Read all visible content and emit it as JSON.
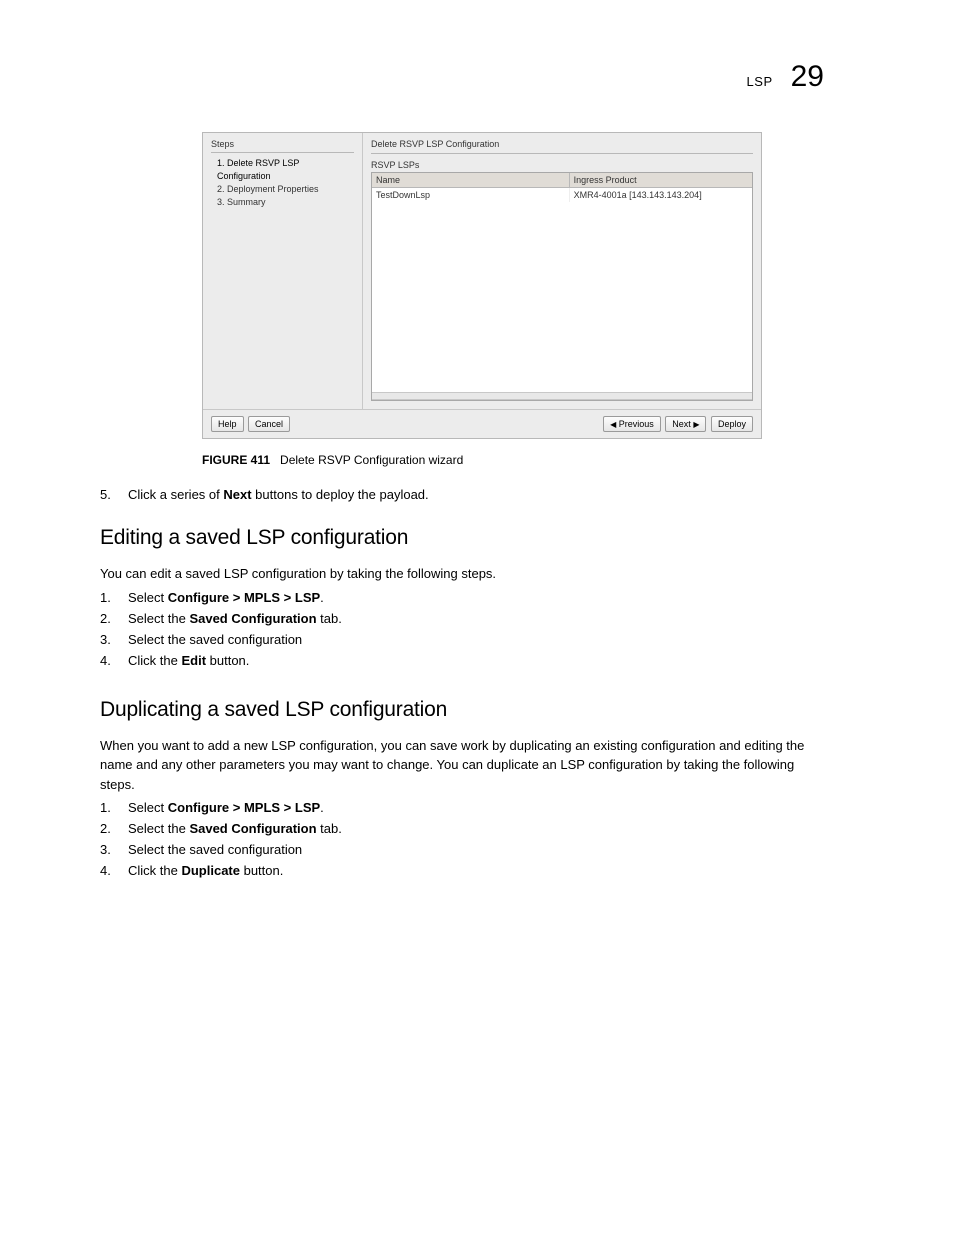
{
  "header": {
    "label": "LSP",
    "pageNumber": "29"
  },
  "wizard": {
    "stepsTitle": "Steps",
    "steps": [
      "1. Delete RSVP LSP Configuration",
      "2. Deployment Properties",
      "3. Summary"
    ],
    "mainTitle": "Delete RSVP LSP Configuration",
    "tableTitle": "RSVP LSPs",
    "columns": {
      "name": "Name",
      "ingress": "Ingress Product"
    },
    "row": {
      "name": "TestDownLsp",
      "ingress": "XMR4-4001a [143.143.143.204]"
    },
    "buttons": {
      "help": "Help",
      "cancel": "Cancel",
      "previous": "Previous",
      "next": "Next",
      "deploy": "Deploy"
    }
  },
  "figure": {
    "label": "FIGURE 411",
    "caption": "Delete RSVP Configuration wizard"
  },
  "step5": {
    "num": "5.",
    "pre": "Click a series of ",
    "bold": "Next",
    "post": " buttons to deploy the payload."
  },
  "sectionA": {
    "title": "Editing a saved LSP configuration",
    "intro": "You can edit a saved LSP configuration by taking the following steps.",
    "s1": {
      "num": "1.",
      "pre": "Select ",
      "bold": "Configure > MPLS > LSP",
      "post": "."
    },
    "s2": {
      "num": "2.",
      "pre": "Select the ",
      "bold": "Saved Configuration",
      "post": " tab."
    },
    "s3": {
      "num": "3.",
      "text": "Select the saved configuration"
    },
    "s4": {
      "num": "4.",
      "pre": "Click the ",
      "bold": "Edit",
      "post": " button."
    }
  },
  "sectionB": {
    "title": "Duplicating a saved LSP configuration",
    "intro": "When you want to add a new LSP configuration, you can save work by duplicating an existing configuration and editing the name and any other parameters you may want to change. You can duplicate an LSP configuration by taking the following steps.",
    "s1": {
      "num": "1.",
      "pre": "Select ",
      "bold": "Configure > MPLS > LSP",
      "post": "."
    },
    "s2": {
      "num": "2.",
      "pre": "Select the ",
      "bold": "Saved Configuration",
      "post": " tab."
    },
    "s3": {
      "num": "3.",
      "text": "Select the saved configuration"
    },
    "s4": {
      "num": "4.",
      "pre": "Click the ",
      "bold": "Duplicate",
      "post": " button."
    }
  }
}
